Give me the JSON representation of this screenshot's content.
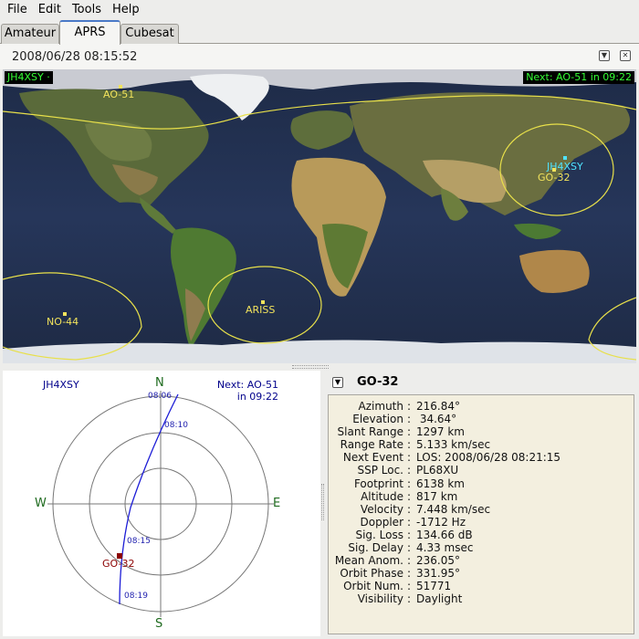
{
  "menu": [
    "File",
    "Edit",
    "Tools",
    "Help"
  ],
  "tabs": [
    {
      "label": "Amateur",
      "active": false
    },
    {
      "label": "APRS",
      "active": true
    },
    {
      "label": "Cubesat",
      "active": false
    }
  ],
  "module": {
    "time": "2008/06/28 08:15:52",
    "dropdown_icon": "triangle-down-icon",
    "close_icon": "close-icon"
  },
  "map": {
    "qth_label": "JH4XSY ·",
    "next_label": "Next: AO-51  in 09:22",
    "ground_station": "JH4XSY",
    "satellites": [
      "AO-51",
      "GO-32",
      "NO-44",
      "ARISS"
    ],
    "colors": {
      "satellite": "#f2e35c",
      "ground_station": "#4fe3ff",
      "info_text": "#35ff35"
    }
  },
  "polar": {
    "qth": "JH4XSY",
    "next_line1": "Next: AO-51",
    "next_line2": "in 09:22",
    "compass": {
      "n": "N",
      "s": "S",
      "e": "E",
      "w": "W"
    },
    "times": [
      "08:06",
      "08:10",
      "08:15",
      "08:19"
    ],
    "satellite": "GO-32"
  },
  "details": {
    "title": "GO-32",
    "rows": [
      {
        "label": "Azimuth",
        "value": "216.84°"
      },
      {
        "label": "Elevation",
        "value": " 34.64°"
      },
      {
        "label": "Slant Range",
        "value": "1297 km"
      },
      {
        "label": "Range Rate",
        "value": "5.133 km/sec"
      },
      {
        "label": "Next Event",
        "value": "LOS: 2008/06/28 08:21:15"
      },
      {
        "label": "SSP Loc.",
        "value": "PL68XU"
      },
      {
        "label": "Footprint",
        "value": "6138 km"
      },
      {
        "label": "Altitude",
        "value": "817 km"
      },
      {
        "label": "Velocity",
        "value": "7.448 km/sec"
      },
      {
        "label": "Doppler",
        "value": "-1712 Hz"
      },
      {
        "label": "Sig. Loss",
        "value": "134.66 dB"
      },
      {
        "label": "Sig. Delay",
        "value": "4.33 msec"
      },
      {
        "label": "Mean Anom.",
        "value": "236.05°"
      },
      {
        "label": "Orbit Phase",
        "value": "331.95°"
      },
      {
        "label": "Orbit Num.",
        "value": "51771"
      },
      {
        "label": "Visibility",
        "value": "Daylight"
      }
    ]
  }
}
